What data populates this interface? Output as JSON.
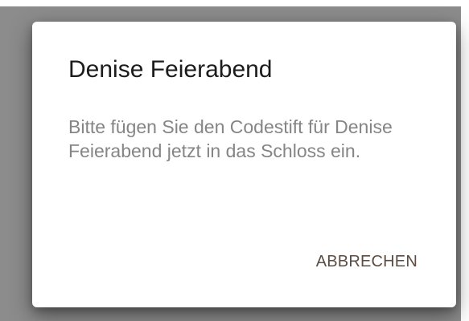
{
  "dialog": {
    "title": "Denise Feierabend",
    "message": "Bitte fügen Sie den Codestift für Denise Feierabend jetzt in das Schloss ein.",
    "cancel_label": "ABBRECHEN"
  },
  "colors": {
    "backdrop": "#8c8c8c",
    "dialog_background": "#ffffff",
    "title_text": "#1c1c1c",
    "message_text": "#858585",
    "button_text": "#5b4d44"
  }
}
